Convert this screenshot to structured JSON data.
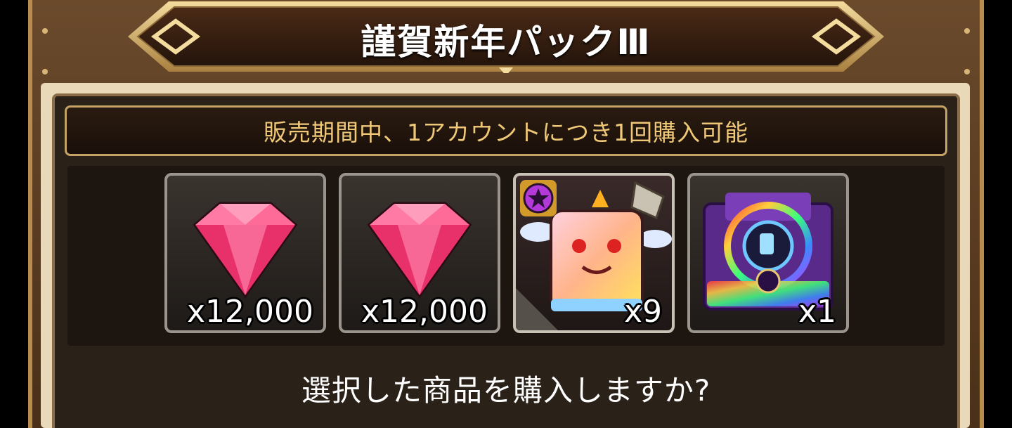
{
  "dialog": {
    "title": "謹賀新年パックⅢ",
    "notice": "販売期間中、1アカウントにつき1回購入可能",
    "question": "選択した商品を購入しますか?"
  },
  "items": [
    {
      "name": "gem",
      "quantity": "x12,000",
      "icon": "pink-gem-icon"
    },
    {
      "name": "gem",
      "quantity": "x12,000",
      "icon": "pink-gem-icon"
    },
    {
      "name": "cube-pet",
      "quantity": "x9",
      "icon": "rainbow-cube-pet-icon",
      "badge": "star-badge-icon"
    },
    {
      "name": "treasure-chest",
      "quantity": "x1",
      "icon": "rainbow-chest-icon"
    }
  ],
  "colors": {
    "frame_gold": "#c4a266",
    "notice_text": "#efc878",
    "panel_bg": "#2a2119",
    "gem_pink": "#ff4f87"
  }
}
